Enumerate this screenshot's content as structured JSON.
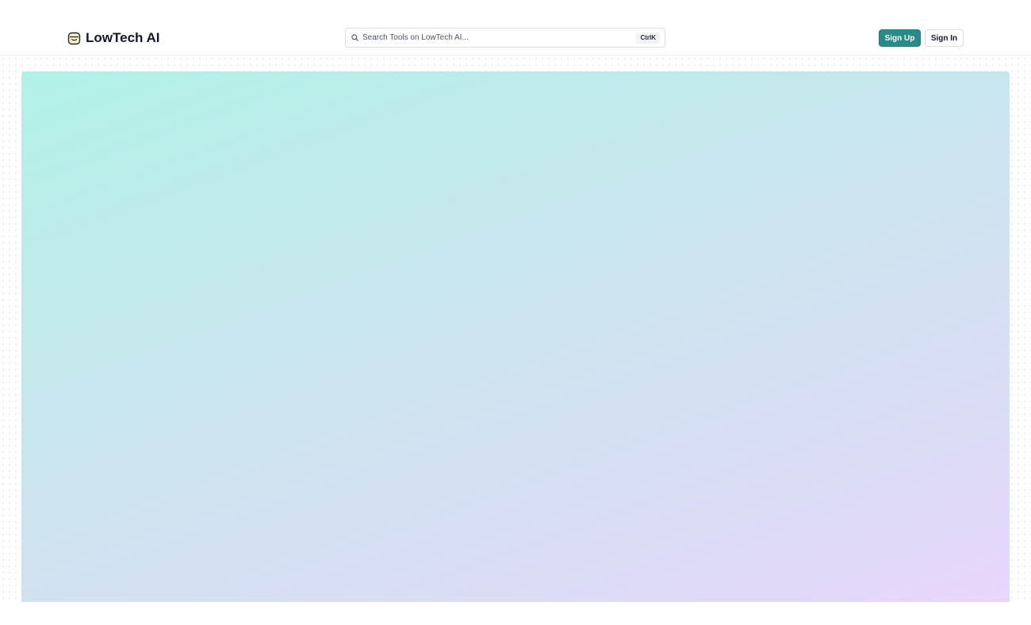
{
  "header": {
    "logo": {
      "icon": "jar-icon",
      "text": "LowTech AI"
    },
    "search": {
      "icon": "search-icon",
      "placeholder": "Search Tools on LowTech AI...",
      "value": "",
      "shortcut": "CtrlK"
    },
    "buttons": {
      "signup_label": "Sign Up",
      "signin_label": "Sign In"
    }
  },
  "colors": {
    "accent": "#2a8a88",
    "hero_gradient_start": "#b1f2e6",
    "hero_gradient_end": "#e9d6fb"
  }
}
